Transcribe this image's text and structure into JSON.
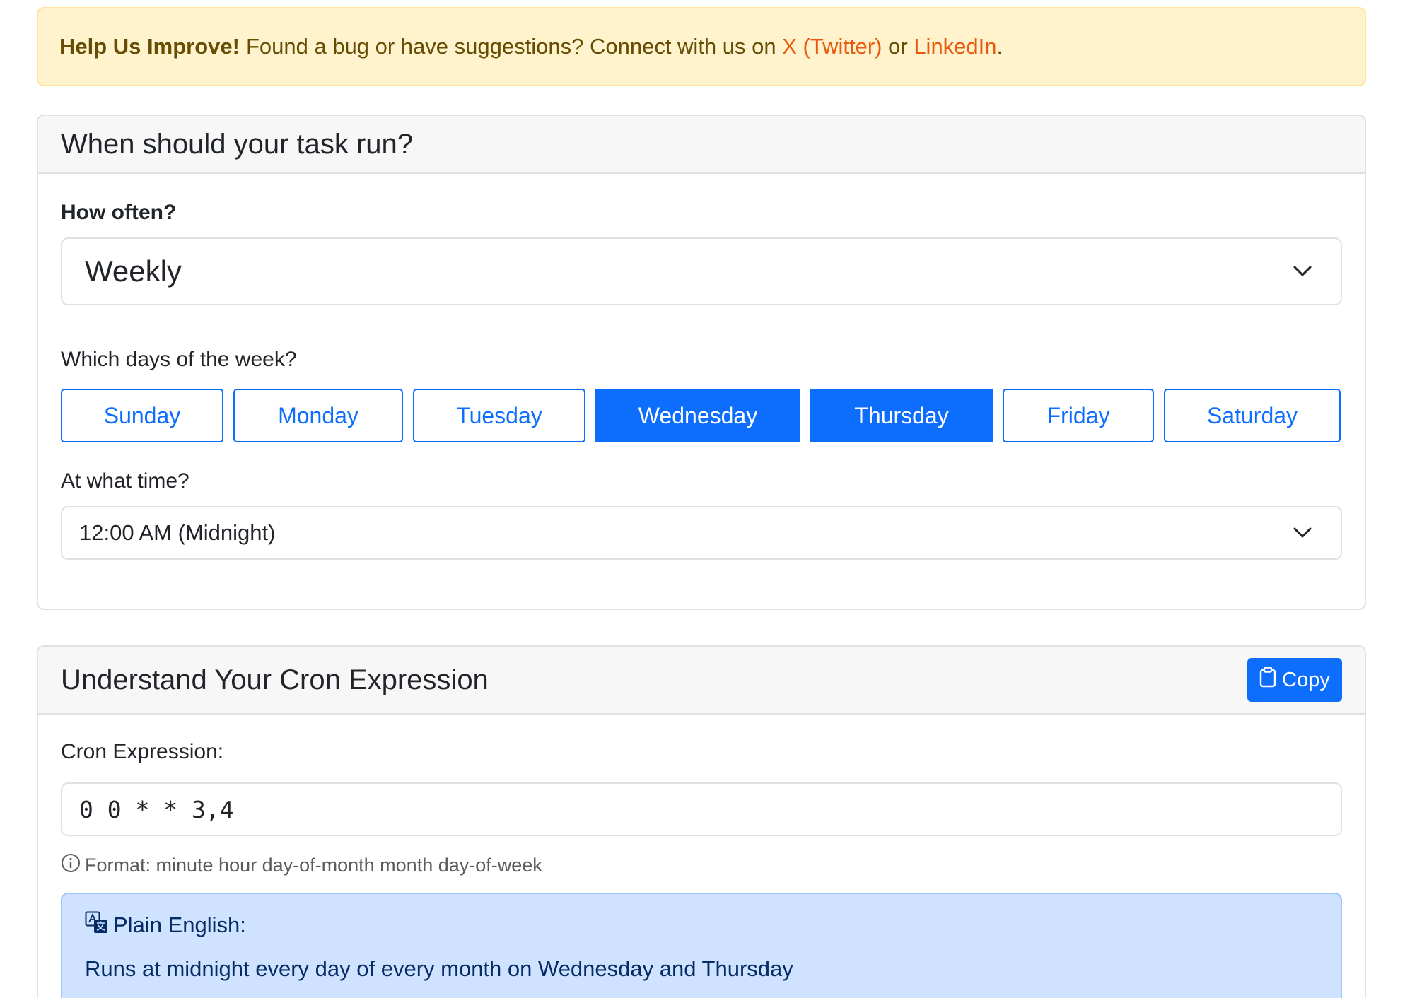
{
  "banner": {
    "strong": "Help Us Improve!",
    "text": "Found a bug or have suggestions? Connect with us on",
    "link_twitter": "X (Twitter)",
    "or": "or",
    "link_linkedin": "LinkedIn",
    "end": "."
  },
  "schedule": {
    "title": "When should your task run?",
    "frequency_label": "How often?",
    "frequency_value": "Weekly",
    "days_label": "Which days of the week?",
    "days": [
      {
        "label": "Sunday",
        "active": false
      },
      {
        "label": "Monday",
        "active": false
      },
      {
        "label": "Tuesday",
        "active": false
      },
      {
        "label": "Wednesday",
        "active": true
      },
      {
        "label": "Thursday",
        "active": true
      },
      {
        "label": "Friday",
        "active": false
      },
      {
        "label": "Saturday",
        "active": false
      }
    ],
    "time_label": "At what time?",
    "time_value": "12:00 AM (Midnight)"
  },
  "cron": {
    "title": "Understand Your Cron Expression",
    "copy_label": "Copy",
    "expression_label": "Cron Expression:",
    "expression_value": "0 0 * * 3,4",
    "format_hint": "Format: minute hour day-of-month month day-of-week",
    "plain_title": "Plain English:",
    "plain_text": "Runs at midnight every day of every month on Wednesday and Thursday"
  },
  "colors": {
    "primary": "#0d6efd",
    "alert_bg": "#fff3cd",
    "link": "#e8590c",
    "info_bg": "#cfe2ff"
  },
  "icons": [
    "chevron-down-icon",
    "clipboard-icon",
    "info-circle-icon",
    "translate-icon"
  ]
}
